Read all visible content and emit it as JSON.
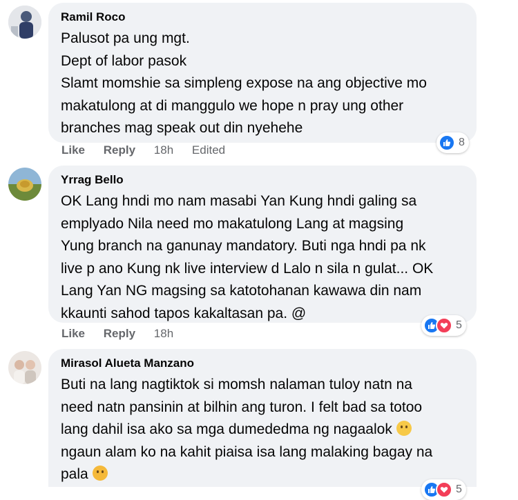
{
  "comments": [
    {
      "author": "Ramil Roco",
      "lines": [
        "Palusot pa ung mgt.",
        "Dept of labor pasok",
        "Slamt momshie sa simpleng expose na ang objective mo",
        "makatulong at di manggulo we hope n pray ung other",
        "branches mag speak out din nyehehe"
      ],
      "actions": {
        "like": "Like",
        "reply": "Reply",
        "time": "18h",
        "edited": "Edited"
      },
      "reactions": {
        "icons": [
          "like-icon"
        ],
        "count": "8"
      }
    },
    {
      "author": "Yrrag Bello",
      "lines": [
        "OK Lang hndi mo nam masabi Yan Kung hndi galing sa",
        "emplyado Nila need mo makatulong Lang at magsing",
        "Yung branch na ganunay mandatory. Buti nga hndi pa nk",
        "live p ano Kung nk live interview d Lalo n sila n gulat... OK",
        "Lang Yan NG magsing sa katotohanan kawawa din nam",
        "kkaunti sahod tapos kakaltasan pa. @"
      ],
      "actions": {
        "like": "Like",
        "reply": "Reply",
        "time": "18h"
      },
      "reactions": {
        "icons": [
          "like-icon",
          "love-icon"
        ],
        "count": "5"
      }
    },
    {
      "author": "Mirasol Alueta Manzano",
      "lines": [
        "Buti na lang nagtiktok si momsh nalaman tuloy natn na",
        "need natn pansinin at bilhin ang turon. I felt bad sa totoo",
        "lang dahil isa ako sa mga dumededma ng nagaalok",
        "ngaun alam ko na kahit piaisa isa lang malaking bagay na",
        "pala"
      ],
      "emoji_lines": {
        "2": "sad-tear-emoji",
        "4": "heart-eyes-emoji"
      },
      "reactions": {
        "icons": [
          "like-icon",
          "love-icon"
        ],
        "count": "5"
      }
    }
  ],
  "colors": {
    "bubble": "#f0f2f5",
    "like": "#1877f2",
    "love": "#f33e58",
    "meta": "#65676b"
  }
}
